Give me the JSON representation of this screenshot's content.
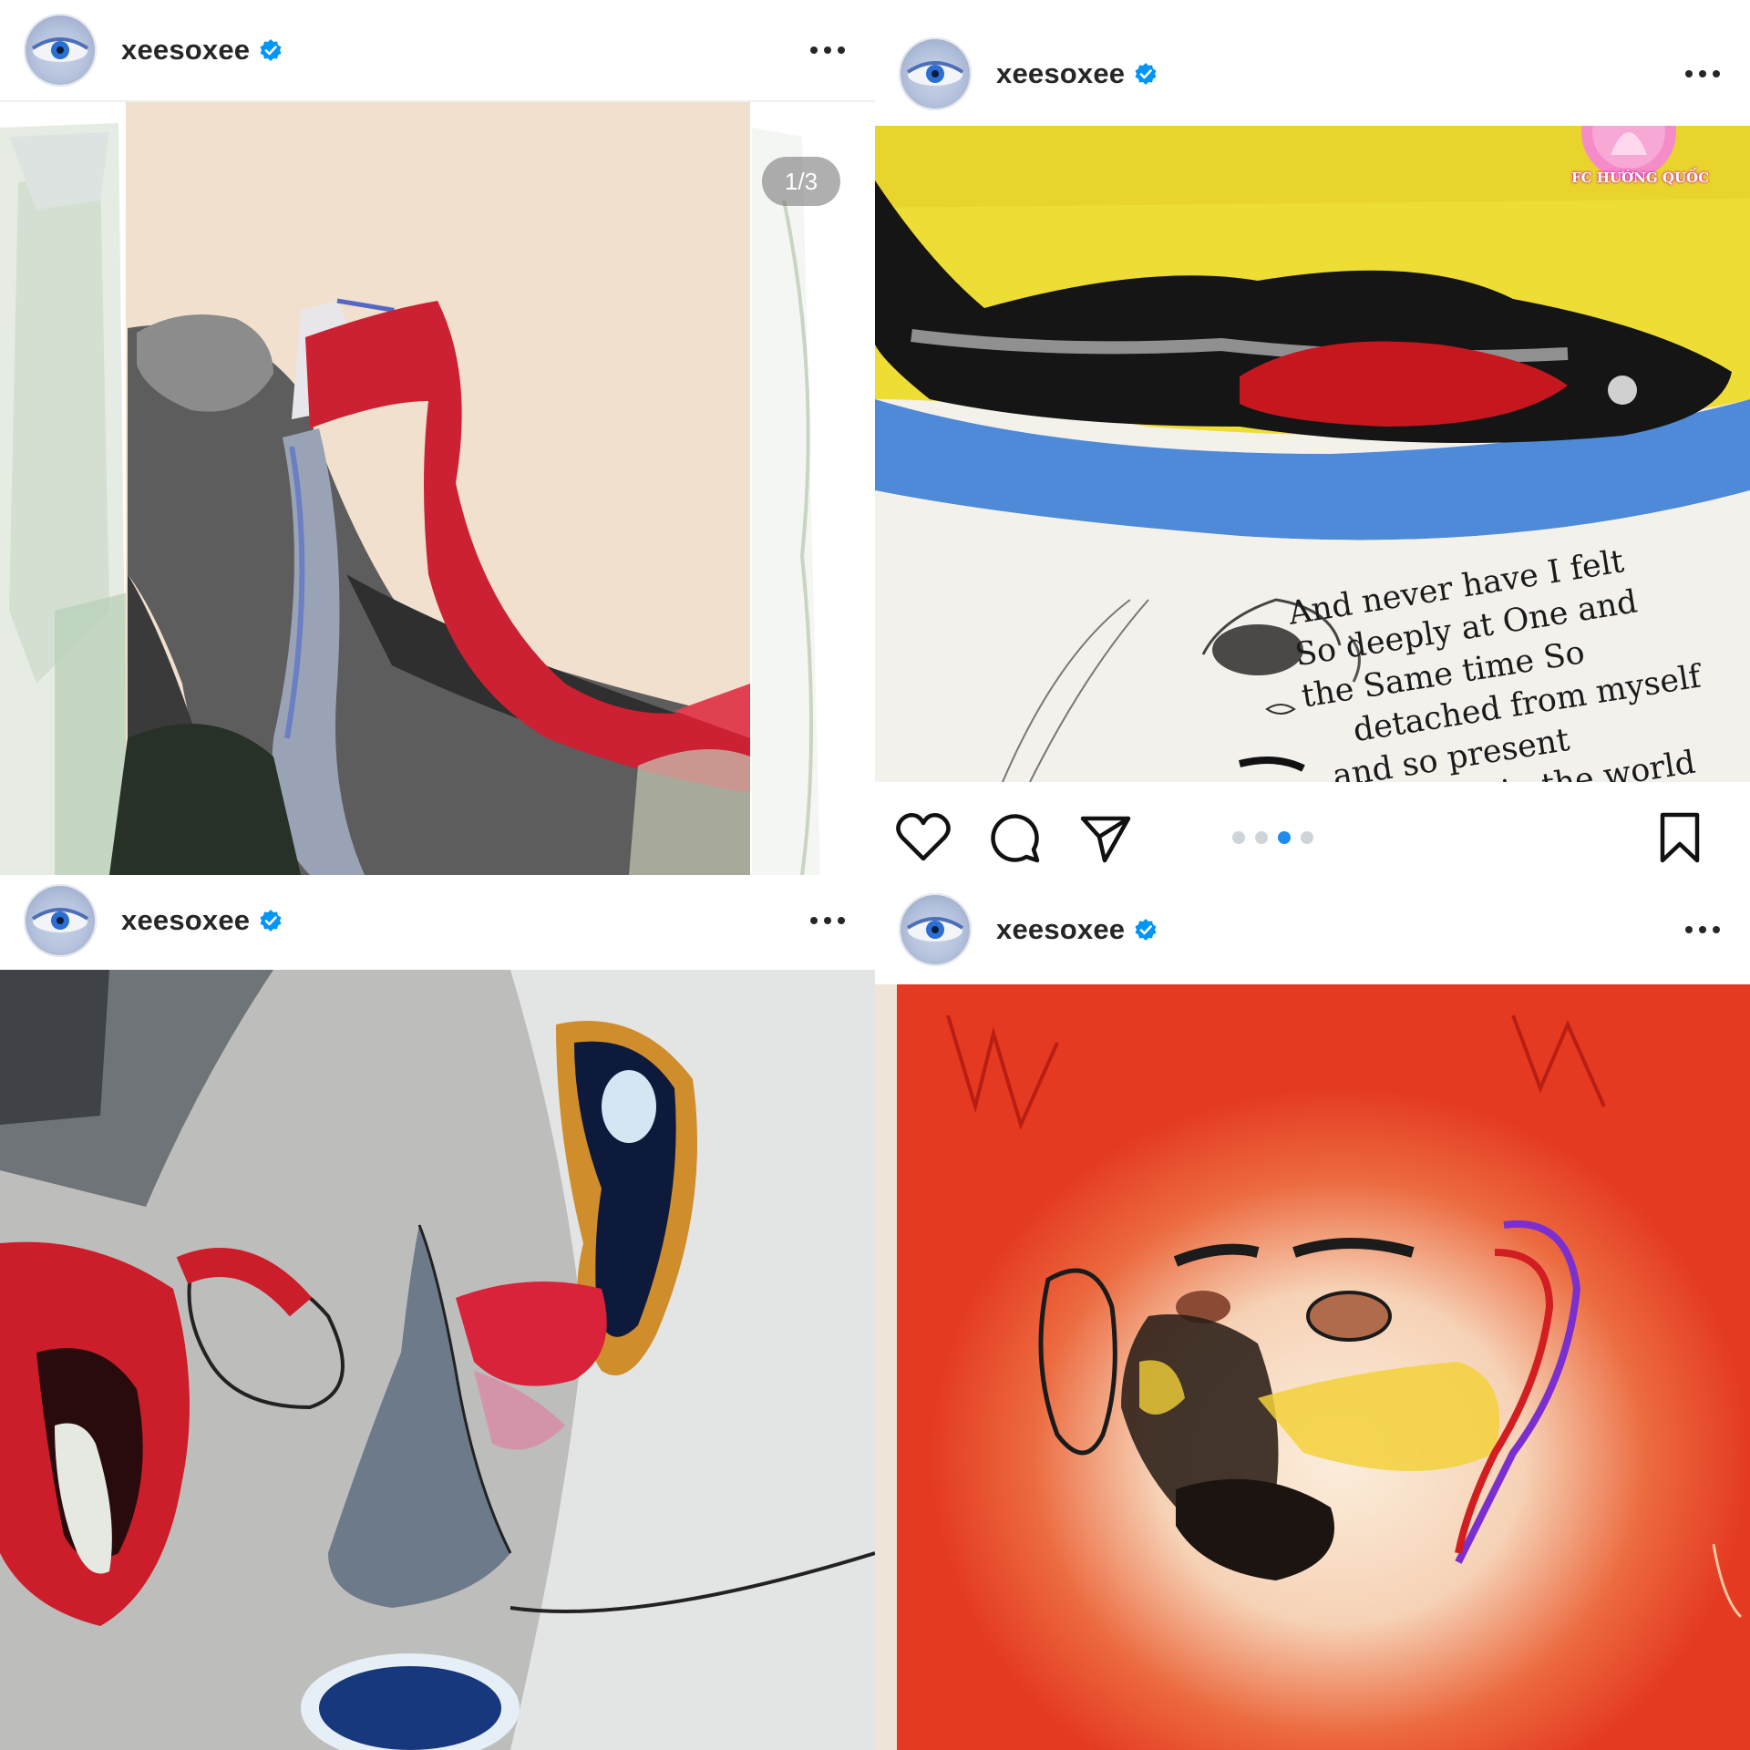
{
  "posts": [
    {
      "username": "xeesoxee",
      "verified": true,
      "image_counter": "1/3"
    },
    {
      "username": "xeesoxee",
      "verified": true,
      "watermark": "FC HƯỚNG QUỐC",
      "caption_lines": [
        "And never have I felt",
        "So deeply at One and",
        "the Same time So",
        "detached from myself",
        "and so present",
        "in the world"
      ],
      "carousel": {
        "count": 4,
        "active_index": 2
      }
    },
    {
      "username": "xeesoxee",
      "verified": true
    },
    {
      "username": "xeesoxee",
      "verified": true
    }
  ],
  "icons": {
    "verified": "verified-badge-icon",
    "more": "more-options-icon",
    "like": "heart-icon",
    "comment": "comment-icon",
    "share": "send-icon",
    "save": "bookmark-icon"
  },
  "colors": {
    "verified_blue": "#0095f6",
    "carousel_active": "#1e8bf0",
    "text": "#262626"
  }
}
